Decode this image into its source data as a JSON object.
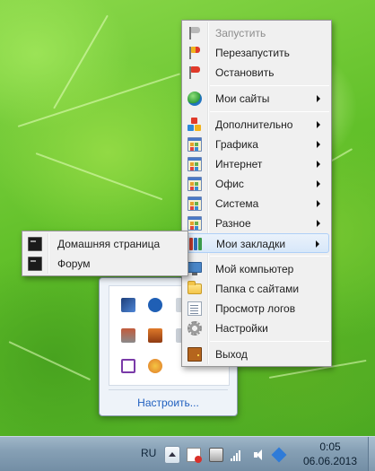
{
  "main_menu": {
    "items": [
      {
        "label": "Запустить",
        "icon": "gray-flag-icon",
        "disabled": true,
        "submenu": false
      },
      {
        "label": "Перезапустить",
        "icon": "red-yellow-flag-icon",
        "disabled": false,
        "submenu": false
      },
      {
        "label": "Остановить",
        "icon": "red-flag-icon",
        "disabled": false,
        "submenu": false
      },
      {
        "label": "Мои сайты",
        "icon": "globe-icon",
        "disabled": false,
        "submenu": true
      },
      {
        "label": "Дополнительно",
        "icon": "blocks-icon",
        "disabled": false,
        "submenu": true
      },
      {
        "label": "Графика",
        "icon": "app-window-icon",
        "disabled": false,
        "submenu": true
      },
      {
        "label": "Интернет",
        "icon": "app-window-icon",
        "disabled": false,
        "submenu": true
      },
      {
        "label": "Офис",
        "icon": "app-window-icon",
        "disabled": false,
        "submenu": true
      },
      {
        "label": "Система",
        "icon": "app-window-icon",
        "disabled": false,
        "submenu": true
      },
      {
        "label": "Разное",
        "icon": "app-window-icon",
        "disabled": false,
        "submenu": true
      },
      {
        "label": "Мои закладки",
        "icon": "books-icon",
        "disabled": false,
        "submenu": true,
        "highlighted": true
      },
      {
        "label": "Мой компьютер",
        "icon": "computer-icon",
        "disabled": false,
        "submenu": false
      },
      {
        "label": "Папка с сайтами",
        "icon": "folder-icon",
        "disabled": false,
        "submenu": false
      },
      {
        "label": "Просмотр логов",
        "icon": "log-icon",
        "disabled": false,
        "submenu": false
      },
      {
        "label": "Настройки",
        "icon": "gear-icon",
        "disabled": false,
        "submenu": false
      },
      {
        "label": "Выход",
        "icon": "exit-door-icon",
        "disabled": false,
        "submenu": false
      }
    ]
  },
  "bookmarks_submenu": {
    "items": [
      {
        "label": "Домашняя страница",
        "icon": "console-icon"
      },
      {
        "label": "Форум",
        "icon": "console-icon"
      }
    ]
  },
  "tray_overflow": {
    "customize_label": "Настроить...",
    "icons": [
      "network-icon",
      "bluetooth-icon",
      "app-tray-icon",
      "printer-icon",
      "toolbox-icon",
      "clip-icon",
      "onenote-icon",
      "palette-icon"
    ]
  },
  "taskbar": {
    "language": "RU",
    "time": "0:05",
    "date": "06.06.2013"
  },
  "colors": {
    "menu_bg": "#f0f0f0",
    "highlight": "#d7e7f9",
    "link": "#1f5fbf",
    "taskbar": "#86a0b5"
  }
}
